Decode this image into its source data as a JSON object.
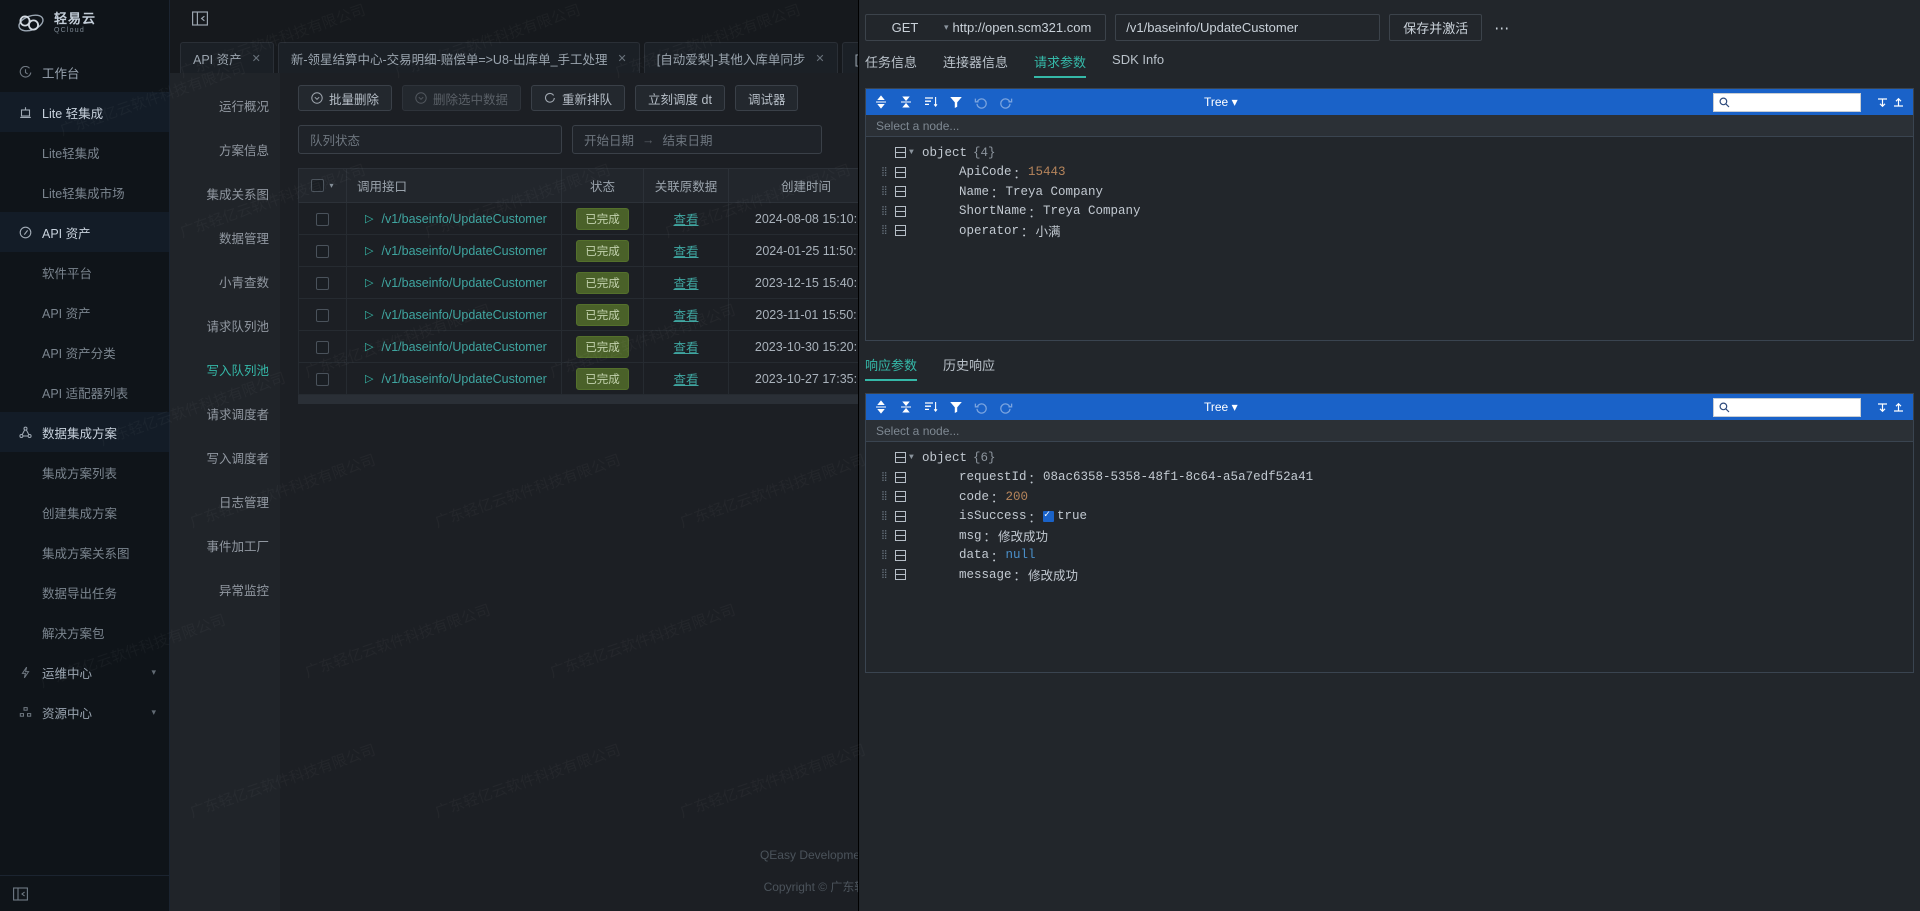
{
  "brand": {
    "cn": "轻易云",
    "en": "QCloud",
    "logo_icon": "cloud-orbit-logo"
  },
  "sidebar": {
    "items": [
      {
        "label": "工作台",
        "icon": "clock-icon",
        "type": "group",
        "active": false,
        "caret": false
      },
      {
        "label": "Lite 轻集成",
        "icon": "lite-icon",
        "type": "group",
        "active": true,
        "caret": false
      },
      {
        "label": "Lite轻集成",
        "type": "sub"
      },
      {
        "label": "Lite轻集成市场",
        "type": "sub"
      },
      {
        "label": "API 资产",
        "icon": "compass-icon",
        "type": "group",
        "active": true,
        "caret": false
      },
      {
        "label": "软件平台",
        "type": "sub"
      },
      {
        "label": "API 资产",
        "type": "sub"
      },
      {
        "label": "API 资产分类",
        "type": "sub"
      },
      {
        "label": "API 适配器列表",
        "type": "sub"
      },
      {
        "label": "数据集成方案",
        "icon": "nodes-icon",
        "type": "group",
        "active": true,
        "caret": false
      },
      {
        "label": "集成方案列表",
        "type": "sub"
      },
      {
        "label": "创建集成方案",
        "type": "sub"
      },
      {
        "label": "集成方案关系图",
        "type": "sub"
      },
      {
        "label": "数据导出任务",
        "type": "sub"
      },
      {
        "label": "解决方案包",
        "type": "sub"
      },
      {
        "label": "运维中心",
        "icon": "bolt-icon",
        "type": "group",
        "active": false,
        "caret": true
      },
      {
        "label": "资源中心",
        "icon": "grid-icon",
        "type": "group",
        "active": false,
        "caret": true
      }
    ],
    "collapse_icon": "collapse-panel-icon"
  },
  "tabbar": {
    "collapse_icon": "collapse-panel-icon",
    "tabs": [
      {
        "label": "API 资产",
        "closable": true
      },
      {
        "label": "新-领星结算中心-交易明细-赔偿单=>U8-出库单_手工处理",
        "closable": true
      },
      {
        "label": "[自动爱梨]-其他入库单同步",
        "closable": true
      },
      {
        "label": "[自动",
        "closable": false
      }
    ]
  },
  "submenu": {
    "items": [
      {
        "label": "运行概况",
        "active": false
      },
      {
        "label": "方案信息",
        "active": false
      },
      {
        "label": "集成关系图",
        "active": false
      },
      {
        "label": "数据管理",
        "active": false
      },
      {
        "label": "小青查数",
        "active": false
      },
      {
        "label": "请求队列池",
        "active": false
      },
      {
        "label": "写入队列池",
        "active": true
      },
      {
        "label": "请求调度者",
        "active": false
      },
      {
        "label": "写入调度者",
        "active": false
      },
      {
        "label": "日志管理",
        "active": false
      },
      {
        "label": "事件加工厂",
        "active": false
      },
      {
        "label": "异常监控",
        "active": false
      }
    ]
  },
  "toolbar": {
    "buttons": [
      {
        "label": "批量删除",
        "icon": "circle-chevron-down-icon",
        "disabled": false
      },
      {
        "label": "删除选中数据",
        "icon": "circle-chevron-down-icon",
        "disabled": true
      },
      {
        "label": "重新排队",
        "icon": "refresh-icon",
        "disabled": false
      },
      {
        "label": "立刻调度 dt",
        "icon": "",
        "disabled": false
      },
      {
        "label": "调试器",
        "icon": "",
        "disabled": false
      }
    ]
  },
  "filters": {
    "queue_status_placeholder": "队列状态",
    "start_date_placeholder": "开始日期",
    "end_date_placeholder": "结束日期",
    "range_arrow": "→"
  },
  "table": {
    "columns": [
      "调用接口",
      "状态",
      "关联原数据",
      "创建时间"
    ],
    "rows": [
      {
        "api": "/v1/baseinfo/UpdateCustomer",
        "status": "已完成",
        "link": "查看",
        "created": "2024-08-08 15:10:"
      },
      {
        "api": "/v1/baseinfo/UpdateCustomer",
        "status": "已完成",
        "link": "查看",
        "created": "2024-01-25 11:50:"
      },
      {
        "api": "/v1/baseinfo/UpdateCustomer",
        "status": "已完成",
        "link": "查看",
        "created": "2023-12-15 15:40:"
      },
      {
        "api": "/v1/baseinfo/UpdateCustomer",
        "status": "已完成",
        "link": "查看",
        "created": "2023-11-01 15:50:"
      },
      {
        "api": "/v1/baseinfo/UpdateCustomer",
        "status": "已完成",
        "link": "查看",
        "created": "2023-10-30 15:20:"
      },
      {
        "api": "/v1/baseinfo/UpdateCustomer",
        "status": "已完成",
        "link": "查看",
        "created": "2023-10-27 17:35:"
      }
    ]
  },
  "footer": {
    "line1": "QEasy Development",
    "line2": "Copyright © 广东轻"
  },
  "api": {
    "method": "GET",
    "host": "http://open.scm321.com",
    "path": "/v1/baseinfo/UpdateCustomer",
    "save_label": "保存并激活",
    "more_icon": "more-horizontal-icon",
    "tabs": [
      {
        "label": "任务信息",
        "active": false
      },
      {
        "label": "连接器信息",
        "active": false
      },
      {
        "label": "请求参数",
        "active": true
      },
      {
        "label": "SDK Info",
        "active": false
      }
    ],
    "response_tabs": [
      {
        "label": "响应参数",
        "active": true
      },
      {
        "label": "历史响应",
        "active": false
      }
    ]
  },
  "json_editor": {
    "mode_label": "Tree",
    "select_node_placeholder": "Select a node...",
    "search_placeholder": "",
    "toolbar_icons": [
      "expand-all-icon",
      "collapse-all-icon",
      "sort-icon",
      "filter-icon",
      "undo-icon",
      "redo-icon"
    ],
    "search_icon": "magnifier-icon"
  },
  "request_json": {
    "root_label": "object",
    "root_count": "{4}",
    "fields": [
      {
        "key": "ApiCode",
        "value": "15443",
        "vtype": "num"
      },
      {
        "key": "Name",
        "value": "Treya Company",
        "vtype": "str"
      },
      {
        "key": "ShortName",
        "value": "Treya Company",
        "vtype": "str"
      },
      {
        "key": "operator",
        "value": "小满",
        "vtype": "str"
      }
    ]
  },
  "response_json": {
    "root_label": "object",
    "root_count": "{6}",
    "fields": [
      {
        "key": "requestId",
        "value": "08ac6358-5358-48f1-8c64-a5a7edf52a41",
        "vtype": "str"
      },
      {
        "key": "code",
        "value": "200",
        "vtype": "num"
      },
      {
        "key": "isSuccess",
        "value": "true",
        "vtype": "bool"
      },
      {
        "key": "msg",
        "value": "修改成功",
        "vtype": "str"
      },
      {
        "key": "data",
        "value": "null",
        "vtype": "null"
      },
      {
        "key": "message",
        "value": "修改成功",
        "vtype": "str"
      }
    ]
  },
  "watermark_text": "广东轻亿云软件科技有限公司",
  "colors": {
    "accent": "#35b8a8",
    "json_toolbar": "#1a62c8",
    "status_badge": "#4a6129",
    "sidebar_bg": "#0f1419"
  }
}
